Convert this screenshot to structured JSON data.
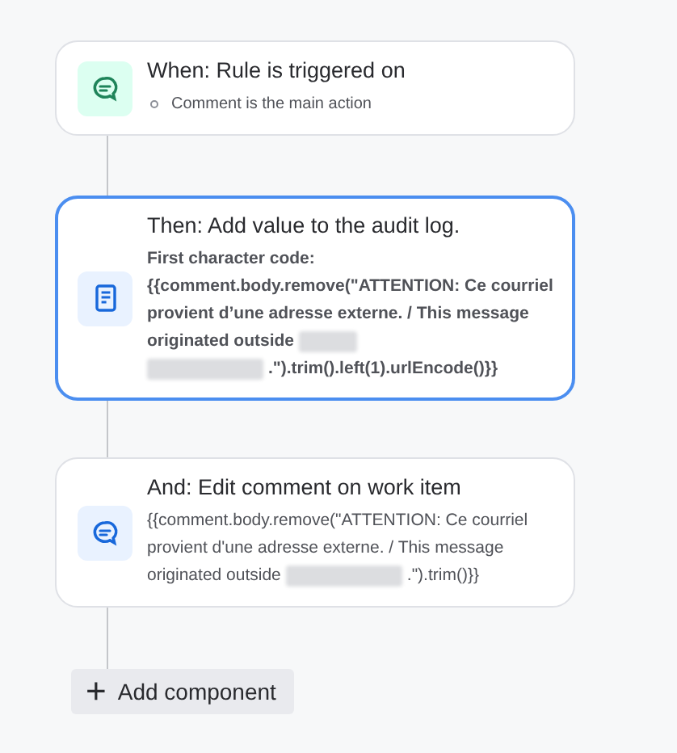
{
  "steps": [
    {
      "kind": "trigger",
      "selected": false,
      "title": "When: Rule is triggered on",
      "bullets": [
        "Comment is the main action"
      ]
    },
    {
      "kind": "audit-log",
      "selected": true,
      "title": "Then: Add value to the audit log.",
      "lines": [
        [
          {
            "kind": "text",
            "text": "First character code:"
          }
        ],
        [
          {
            "kind": "text",
            "text": "{{comment.body.remove(\"ATTENTION: Ce courriel"
          }
        ],
        [
          {
            "kind": "text",
            "text": "provient d’une adresse externe. / This message"
          }
        ],
        [
          {
            "kind": "text",
            "text": "originated outside"
          },
          {
            "kind": "redaction"
          }
        ],
        [
          {
            "kind": "redaction"
          },
          {
            "kind": "text",
            "text": ".\").trim().left(1).urlEncode()}}"
          }
        ]
      ]
    },
    {
      "kind": "edit-comment",
      "selected": false,
      "title": "And: Edit comment on work item",
      "lines": [
        [
          {
            "kind": "text",
            "text": "{{comment.body.remove(\"ATTENTION: Ce courriel"
          }
        ],
        [
          {
            "kind": "text",
            "text": "provient d'une adresse externe. / This message"
          }
        ],
        [
          {
            "kind": "text",
            "text": "originated outside"
          },
          {
            "kind": "redaction"
          },
          {
            "kind": "text",
            "text": ".\").trim()}}"
          }
        ]
      ]
    }
  ],
  "add_button": {
    "label": "Add component",
    "icon": "+"
  }
}
